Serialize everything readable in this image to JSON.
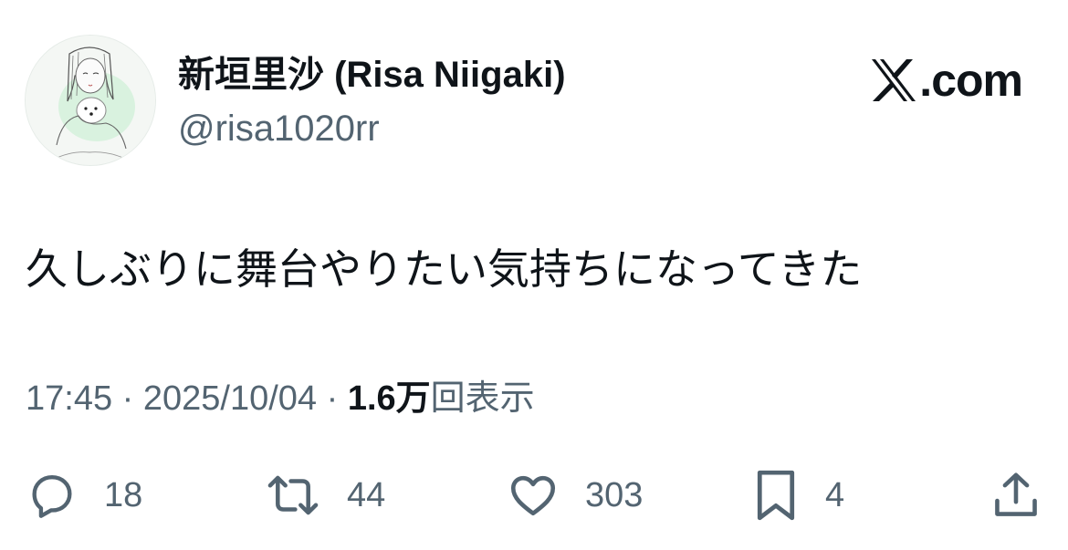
{
  "author": {
    "display_name": "新垣里沙 (Risa Niigaki)",
    "handle": "@risa1020rr",
    "avatar_icon": "profile-avatar"
  },
  "brand": {
    "logo_icon": "x-logo-icon",
    "domain": ".com"
  },
  "tweet": {
    "text": "久しぶりに舞台やりたい気持ちになってきた"
  },
  "meta": {
    "time": "17:45",
    "separator": " · ",
    "date": "2025/10/04",
    "views_count": "1.6万",
    "views_label": "回表示"
  },
  "actions": {
    "reply": {
      "icon": "reply-icon",
      "count": "18"
    },
    "retweet": {
      "icon": "retweet-icon",
      "count": "44"
    },
    "like": {
      "icon": "heart-icon",
      "count": "303"
    },
    "bookmark": {
      "icon": "bookmark-icon",
      "count": "4"
    },
    "share": {
      "icon": "share-icon"
    }
  },
  "colors": {
    "text_primary": "#0f1419",
    "text_secondary": "#536471",
    "background": "#ffffff"
  }
}
